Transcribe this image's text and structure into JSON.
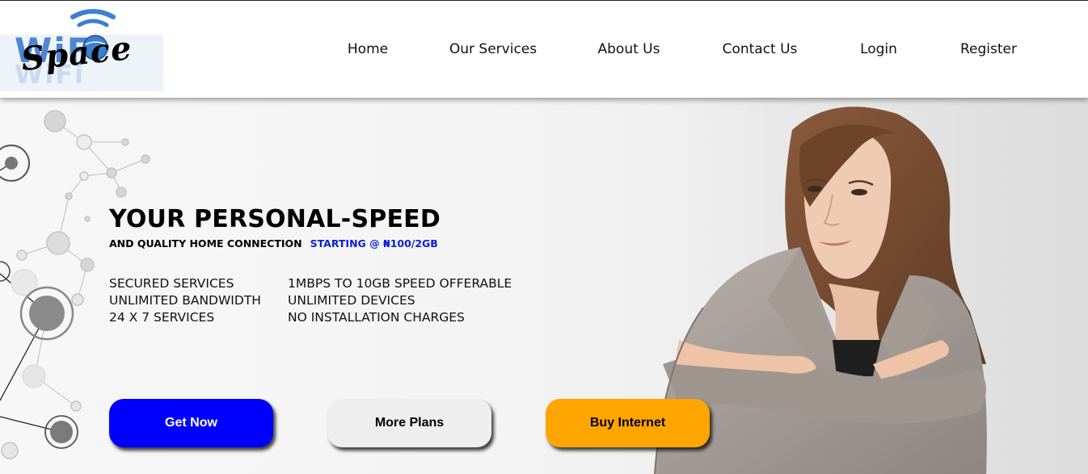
{
  "brand": {
    "logo_text": "Space",
    "logo_wordmark": "WiFi"
  },
  "nav": {
    "items": [
      {
        "label": "Home"
      },
      {
        "label": "Our Services"
      },
      {
        "label": "About Us"
      },
      {
        "label": "Contact Us"
      },
      {
        "label": "Login"
      },
      {
        "label": "Register"
      }
    ]
  },
  "hero": {
    "headline": "YOUR PERSONAL-SPEED",
    "subline": "AND QUALITY HOME CONNECTION",
    "price_tag": "STARTING @ ₦100/2GB",
    "features_left": [
      "SECURED SERVICES",
      "UNLIMITED BANDWIDTH",
      "24 X 7 SERVICES"
    ],
    "features_right": [
      "1MBPS TO 10GB SPEED OFFERABLE",
      "UNLIMITED DEVICES",
      "NO INSTALLATION CHARGES"
    ]
  },
  "buttons": {
    "get_now": {
      "label": "Get Now",
      "bg": "#0000ff",
      "color": "#ffffff"
    },
    "more_plans": {
      "label": "More Plans",
      "bg": "#eeeeee",
      "color": "#000000"
    },
    "buy_internet": {
      "label": "Buy Internet",
      "bg": "#ffa500",
      "color": "#000000"
    }
  },
  "colors": {
    "accent_blue": "#0a1ed8",
    "wifi_blue": "#3d7fd1"
  },
  "icons": [
    "wifi-logo-icon",
    "network-nodes-graphic",
    "woman-photo"
  ]
}
